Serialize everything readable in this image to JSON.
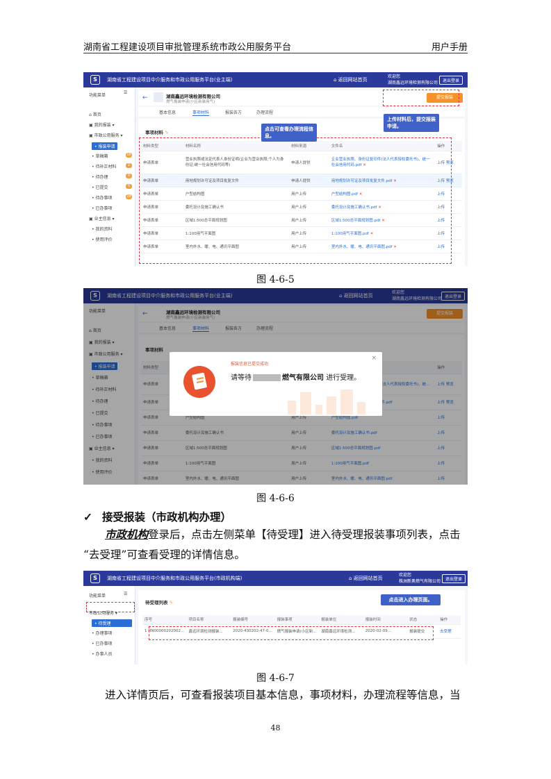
{
  "header": {
    "left": "湖南省工程建设项目审批管理系统市政公用服务平台",
    "right": "用户手册"
  },
  "fig1": {
    "title": "湖南省工程建设项目中介服务和市政公用服务平台(业主端)",
    "home": "返回网站首页",
    "welcome_1": "欢迎您",
    "welcome_2": "湖南鑫远环境检测有限公司",
    "logout": "退出登录",
    "side_title": "功能菜单",
    "side_items": [
      "首页",
      "我的报装",
      "市政公用服务",
      "报装申请",
      "草稿箱",
      "待补正材料",
      "待办理",
      "已提交",
      "待办事项",
      "已办事项",
      "业主信息",
      "我的资料",
      "使用评价"
    ],
    "side_badges": [
      "16",
      "2",
      "0",
      "0",
      "28"
    ],
    "company": "湖南鑫远环境检测有限公司",
    "project": "燃气报装申请(小区新装用气)",
    "submit_btn": "提交报装",
    "tabs": [
      "基本信息",
      "事项材料",
      "报装各方",
      "办理流程"
    ],
    "section": "事项材料",
    "cols": [
      "材料类型",
      "材料名称",
      "材料来源",
      "文件名",
      "操作"
    ],
    "rows": [
      [
        "申请表单",
        "营业执照或法定代表人身份证明(企业为营业执照;个人为身份证;统一社会信用代码等)",
        "申请人提供",
        "企业营业执照、身份证复印件(法人代表授权委托书)、统一社会信用代码.pdf",
        "上传 预览"
      ],
      [
        "申请表单",
        "用地规划许可证及项目批复文件",
        "申请人提供",
        "用地规划许可证及项目批复文件.pdf",
        "上传 预览"
      ],
      [
        "申请表单",
        "户型结构图",
        "用户上传",
        "户型结构图.pdf",
        "上传"
      ],
      [
        "申请表单",
        "委托设计及施工确认书",
        "用户上传",
        "委托设计及施工确认书.pdf",
        "上传"
      ],
      [
        "申请表单",
        "区域1:500总平面规划图",
        "用户上传",
        "区域1:500总平面规划图.pdf",
        "上传"
      ],
      [
        "申请表单",
        "1:100用气平面图",
        "用户上传",
        "1:100用气平面图.pdf",
        "上传"
      ],
      [
        "申请表单",
        "室内外水、暖、电、通讯平面图",
        "用户上传",
        "室内外水、暖、电、通讯平面图.pdf",
        "上传"
      ]
    ],
    "callout_a": "点击可查看办理流程信息。",
    "callout_b": "上传材料后，提交报装申请。"
  },
  "caption1": "图 4-6-5",
  "fig2": {
    "title": "湖南省工程建设项目中介服务和市政公用服务平台(业主端)",
    "home": "返回网站首页",
    "welcome_1": "欢迎您",
    "welcome_2": "湖南鑫远环境检测有限公司",
    "logout": "退出登录",
    "submit_btn": "提交报装",
    "modal_line1": "报装信息已提交成功",
    "modal_line2": "请等待",
    "modal_company": "燃气有限公司",
    "modal_line3": "进行受理。",
    "close": "×"
  },
  "caption2": "图 4-6-6",
  "section_heading": "接受报装（市政机构办理）",
  "check_mark": "✓",
  "para1_emph": "市政机构",
  "para1_a": "登录后，点击左侧菜单【待受理】进入待受理报装事项列表，点击",
  "para1_b": "“去受理”可查看受理的详情信息。",
  "fig3": {
    "title": "湖南省工程建设项目中介服务和市政公用服务平台(市政机构端)",
    "home": "返回网站首页",
    "welcome_1": "欢迎您",
    "welcome_2": "株洲新奥燃气有限公司",
    "logout": "退出登录",
    "side_title": "功能菜单",
    "side_items": [
      "市政公用服务",
      "待受理",
      "办理事项",
      "已办事项",
      "办事人员"
    ],
    "section": "待受理列表",
    "cols": [
      "序号",
      "项目名称",
      "报装编号",
      "报装时间",
      "报装事项",
      "报装单位",
      "报装时间",
      "状态",
      "操作"
    ],
    "row": [
      "1 HN0000020200209...",
      "鑫远环境检测报装...",
      "2020-430202-47-03...",
      "燃气报装申请(小区新...",
      "湖南鑫远环境检测...",
      "2020-02-09...",
      "报装提交",
      "去受理"
    ],
    "callout": "点击进入办理页面。"
  },
  "caption3": "图 4-6-7",
  "para2": "进入详情页后，可查看报装项目基本信息，事项材料，办理流程等信息，当",
  "page_number": "48"
}
